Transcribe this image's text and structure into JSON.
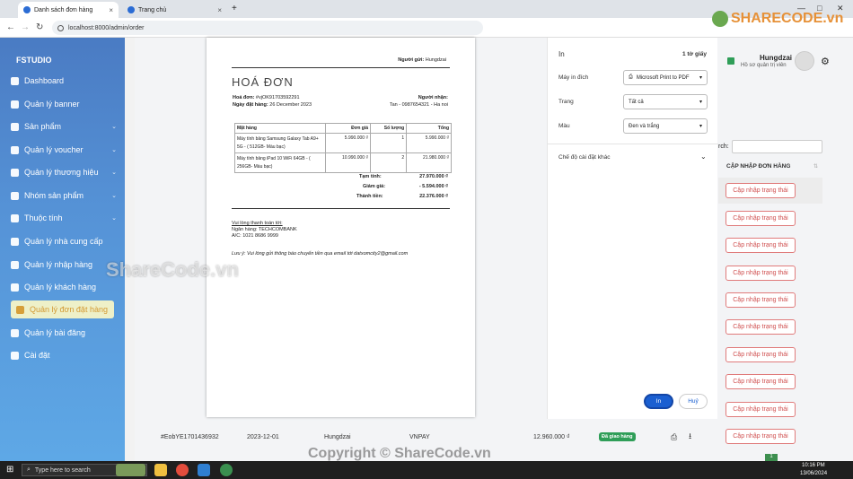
{
  "browser": {
    "tabs": [
      {
        "label": "Danh sách đơn hàng",
        "active": true
      },
      {
        "label": "Trang chủ",
        "active": false
      }
    ],
    "url": "localhost:8000/admin/order",
    "new_tab": "+",
    "controls": {
      "min": "—",
      "max": "□",
      "close": "✕"
    }
  },
  "sidebar": {
    "brand": "FSTUDIO",
    "items": [
      {
        "label": "Dashboard",
        "icon": "home-icon",
        "chev": ""
      },
      {
        "label": "Quản lý banner",
        "icon": "banner-icon",
        "chev": ""
      },
      {
        "label": "Sản phẩm",
        "icon": "box-icon",
        "chev": "⌄"
      },
      {
        "label": "Quản lý voucher",
        "icon": "voucher-icon",
        "chev": "⌄"
      },
      {
        "label": "Quản lý thương hiệu",
        "icon": "brand-icon",
        "chev": "⌄"
      },
      {
        "label": "Nhóm sản phẩm",
        "icon": "group-icon",
        "chev": "⌄"
      },
      {
        "label": "Thuộc tính",
        "icon": "attribute-icon",
        "chev": "⌄"
      },
      {
        "label": "Quản lý nhà cung cấp",
        "icon": "supplier-icon",
        "chev": ""
      },
      {
        "label": "Quản lý nhập hàng",
        "icon": "cart-icon",
        "chev": "⌄"
      },
      {
        "label": "Quản lý khách hàng",
        "icon": "user-icon",
        "chev": ""
      },
      {
        "label": "Quản lý đơn đặt hàng",
        "icon": "order-icon",
        "chev": "",
        "active": true
      },
      {
        "label": "Quản lý bài đăng",
        "icon": "post-icon",
        "chev": ""
      },
      {
        "label": "Cài đặt",
        "icon": "settings-icon",
        "chev": ""
      }
    ]
  },
  "header": {
    "user": "Hungdzai",
    "role": "Hồ sơ quản trị viên"
  },
  "table": {
    "search_label": "rch:",
    "column": "CẬP NHẬP ĐƠN HÀNG",
    "update_label": "Cập nhập trạng thái",
    "row": {
      "id": "#EobYE1701436932",
      "date": "2023-12-01",
      "customer": "Hungdzai",
      "payment": "VNPAY",
      "total": "12.960.000 ₫",
      "status": "Đã giao hàng"
    },
    "pager": "1"
  },
  "invoice": {
    "sender_label": "Người gửi:",
    "sender": "Hungdzai",
    "title": "HOÁ ĐƠN",
    "code_label": "Hoá đơn:",
    "code": "#vjOK91703592291",
    "date_label": "Ngày đặt hàng:",
    "date": "26 December 2023",
    "receiver_label": "Người nhận:",
    "receiver_info": "Tan - 0987654321 - Ha noi",
    "columns": [
      "Mặt hàng",
      "Đơn giá",
      "Số lượng",
      "Tổng"
    ],
    "items": [
      {
        "name": "Máy tính bảng Samsung Galaxy Tab A9+ 5G - ( 512GB- Màu bạc)",
        "price": "5.990.000 ₫",
        "qty": "1",
        "total": "5.990.000 ₫"
      },
      {
        "name": "Máy tính bảng iPad 10 WiFi 64GB - ( 256GB- Màu bạc)",
        "price": "10.990.000 ₫",
        "qty": "2",
        "total": "21.980.000 ₫"
      }
    ],
    "subtotal_label": "Tạm tính:",
    "subtotal": "27.970.000 ₫",
    "discount_label": "Giảm giá:",
    "discount": "- 5.594.000 ₫",
    "grand_label": "Thành tiền:",
    "grand": "22.376.000 ₫",
    "pay_note": "Vui lòng thanh toán tới:",
    "bank": "Ngân hàng: TECHCOMBANK",
    "account": "A/C: 1021 8686 9999",
    "footnote": "Lưu ý: Vui lòng gửi thông báo chuyển tiền qua email tới datxomcity2@gmail.com"
  },
  "print_dialog": {
    "title": "In",
    "pages": "1 tờ giấy",
    "dest_label": "Máy in đích",
    "dest": "Microsoft Print to PDF",
    "page_label": "Trang",
    "page": "Tất cả",
    "color_label": "Màu",
    "color": "Đen và trắng",
    "more": "Chế độ cài đặt khác",
    "print": "In",
    "cancel": "Huỷ"
  },
  "taskbar": {
    "search": "Type here to search",
    "time": "10:16 PM",
    "date": "13/06/2024"
  },
  "watermarks": {
    "brand": "SHARECODE.vn",
    "center": "ShareCode.vn",
    "bottom": "Copyright © ShareCode.vn"
  }
}
